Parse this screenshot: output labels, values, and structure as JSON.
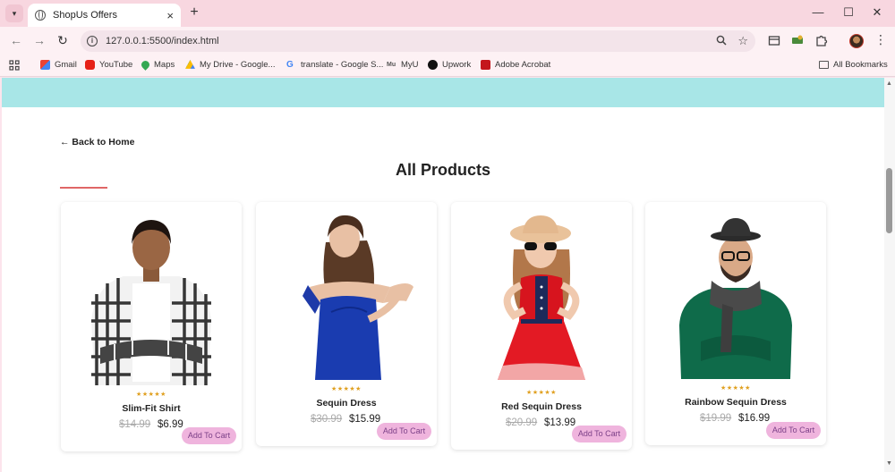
{
  "browser": {
    "tab_title": "ShopUs Offers",
    "tab_close": "×",
    "new_tab": "+",
    "url": "127.0.0.1:5500/index.html",
    "window_controls": {
      "minimize": "—",
      "maximize": "☐",
      "close": "✕"
    }
  },
  "bookmarks": [
    {
      "label": "Gmail",
      "icon": "gmail-icon"
    },
    {
      "label": "YouTube",
      "icon": "youtube-icon"
    },
    {
      "label": "Maps",
      "icon": "maps-icon"
    },
    {
      "label": "My Drive - Google...",
      "icon": "drive-icon"
    },
    {
      "label": "translate - Google S...",
      "icon": "google-icon"
    },
    {
      "label": "MyU",
      "icon": "myu-icon"
    },
    {
      "label": "Upwork",
      "icon": "upwork-icon"
    },
    {
      "label": "Adobe Acrobat",
      "icon": "acrobat-icon"
    }
  ],
  "all_bookmarks": "All Bookmarks",
  "page": {
    "back_label": "← Back to Home",
    "heading": "All Products",
    "accent_color": "#e06666",
    "banner_color": "#a8e6e7"
  },
  "products": [
    {
      "name": "Slim-Fit Shirt",
      "old_price": "$14.99",
      "price": "$6.99",
      "rating": "★★★★★",
      "button": "Add To Cart"
    },
    {
      "name": "Sequin Dress",
      "old_price": "$30.99",
      "price": "$15.99",
      "rating": "★★★★★",
      "button": "Add To Cart"
    },
    {
      "name": "Red Sequin Dress",
      "old_price": "$20.99",
      "price": "$13.99",
      "rating": "★★★★★",
      "button": "Add To Cart"
    },
    {
      "name": "Rainbow Sequin Dress",
      "old_price": "$19.99",
      "price": "$16.99",
      "rating": "★★★★★",
      "button": "Add To Cart"
    }
  ]
}
